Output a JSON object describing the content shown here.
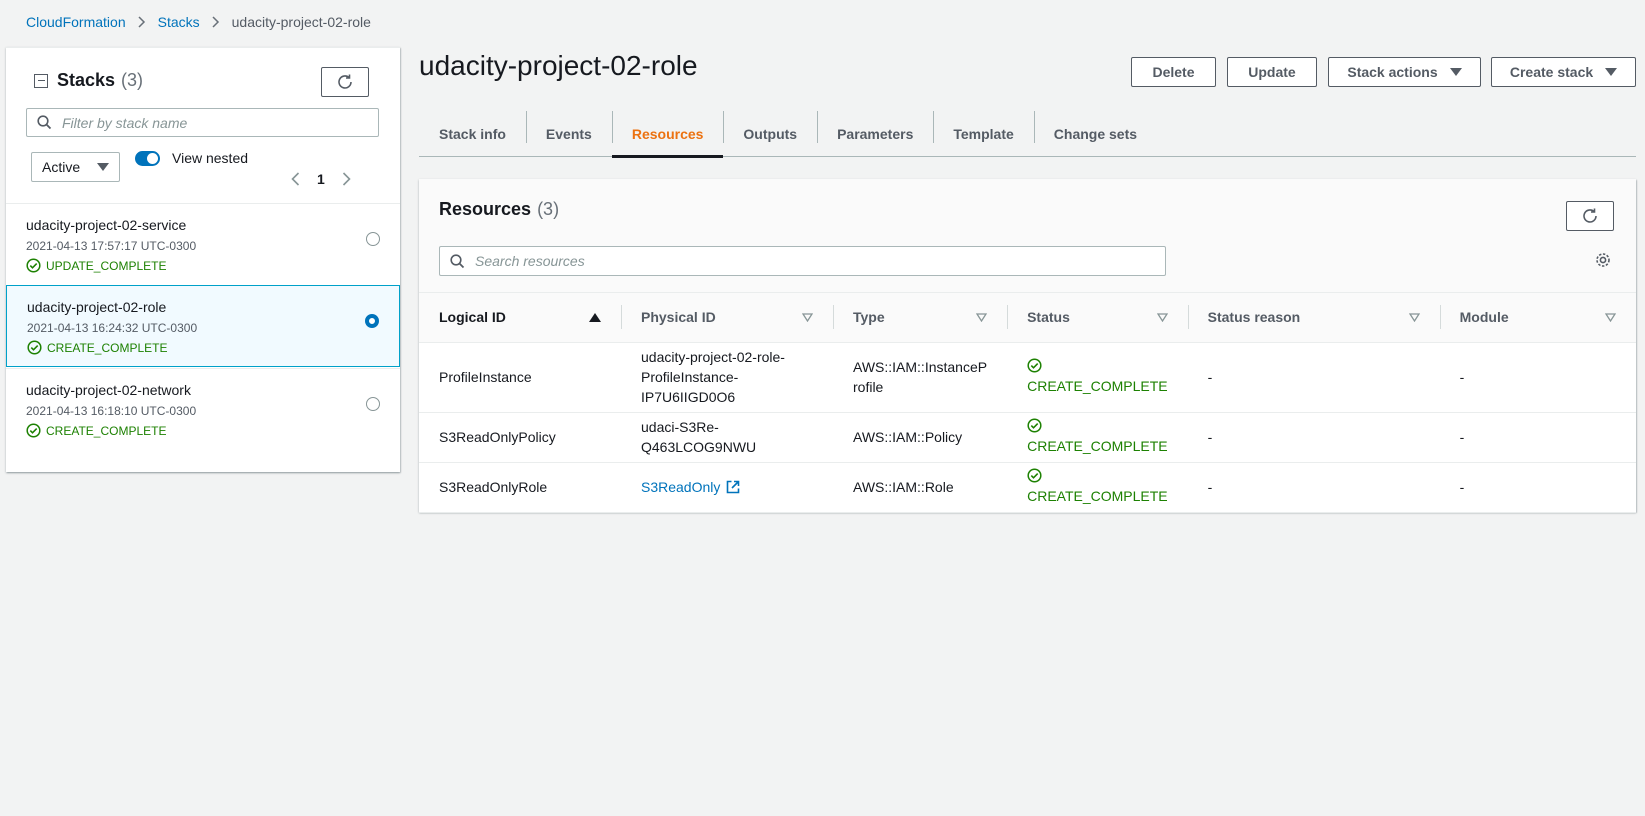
{
  "breadcrumb": {
    "items": [
      "CloudFormation",
      "Stacks"
    ],
    "current": "udacity-project-02-role"
  },
  "stacks_panel": {
    "title": "Stacks",
    "count": "(3)",
    "filter_placeholder": "Filter by stack name",
    "status_filter": "Active",
    "view_nested_label": "View nested",
    "view_nested_on": true,
    "page": "1",
    "stacks": [
      {
        "name": "udacity-project-02-service",
        "time": "2021-04-13 17:57:17 UTC-0300",
        "status": "UPDATE_COMPLETE",
        "selected": false
      },
      {
        "name": "udacity-project-02-role",
        "time": "2021-04-13 16:24:32 UTC-0300",
        "status": "CREATE_COMPLETE",
        "selected": true
      },
      {
        "name": "udacity-project-02-network",
        "time": "2021-04-13 16:18:10 UTC-0300",
        "status": "CREATE_COMPLETE",
        "selected": false
      }
    ]
  },
  "main": {
    "title": "udacity-project-02-role",
    "buttons": {
      "delete": "Delete",
      "update": "Update",
      "stack_actions": "Stack actions",
      "create_stack": "Create stack"
    },
    "tabs": [
      "Stack info",
      "Events",
      "Resources",
      "Outputs",
      "Parameters",
      "Template",
      "Change sets"
    ],
    "active_tab": "Resources"
  },
  "resources": {
    "title": "Resources",
    "count": "(3)",
    "search_placeholder": "Search resources",
    "columns": [
      "Logical ID",
      "Physical ID",
      "Type",
      "Status",
      "Status reason",
      "Module"
    ],
    "rows": [
      {
        "logical_id": "ProfileInstance",
        "physical_id_lines": [
          "udacity-project-02-role-",
          "ProfileInstance-",
          "IP7U6IIGD0O6"
        ],
        "type_lines": [
          "AWS::IAM::InstanceP",
          "rofile"
        ],
        "status": "CREATE_COMPLETE",
        "status_reason": "-",
        "module": "-"
      },
      {
        "logical_id": "S3ReadOnlyPolicy",
        "physical_id_lines": [
          "udaci-S3Re-",
          "Q463LCOG9NWU"
        ],
        "type_lines": [
          "AWS::IAM::Policy"
        ],
        "status": "CREATE_COMPLETE",
        "status_reason": "-",
        "module": "-"
      },
      {
        "logical_id": "S3ReadOnlyRole",
        "physical_id_link": "S3ReadOnly",
        "type_lines": [
          "AWS::IAM::Role"
        ],
        "status": "CREATE_COMPLETE",
        "status_reason": "-",
        "module": "-"
      }
    ]
  },
  "colors": {
    "link": "#0073bb",
    "success": "#1d8102",
    "active_tab": "#ec7211",
    "selected_border": "#00a1c9"
  },
  "icons": [
    "collapse-icon",
    "refresh-icon",
    "search-icon",
    "chevron-left-icon",
    "chevron-right-icon",
    "success-icon",
    "radio-icon",
    "settings-gear-icon",
    "sort-ascending-icon",
    "filter-caret-icon",
    "external-link-icon",
    "breadcrumb-separator-icon"
  ]
}
